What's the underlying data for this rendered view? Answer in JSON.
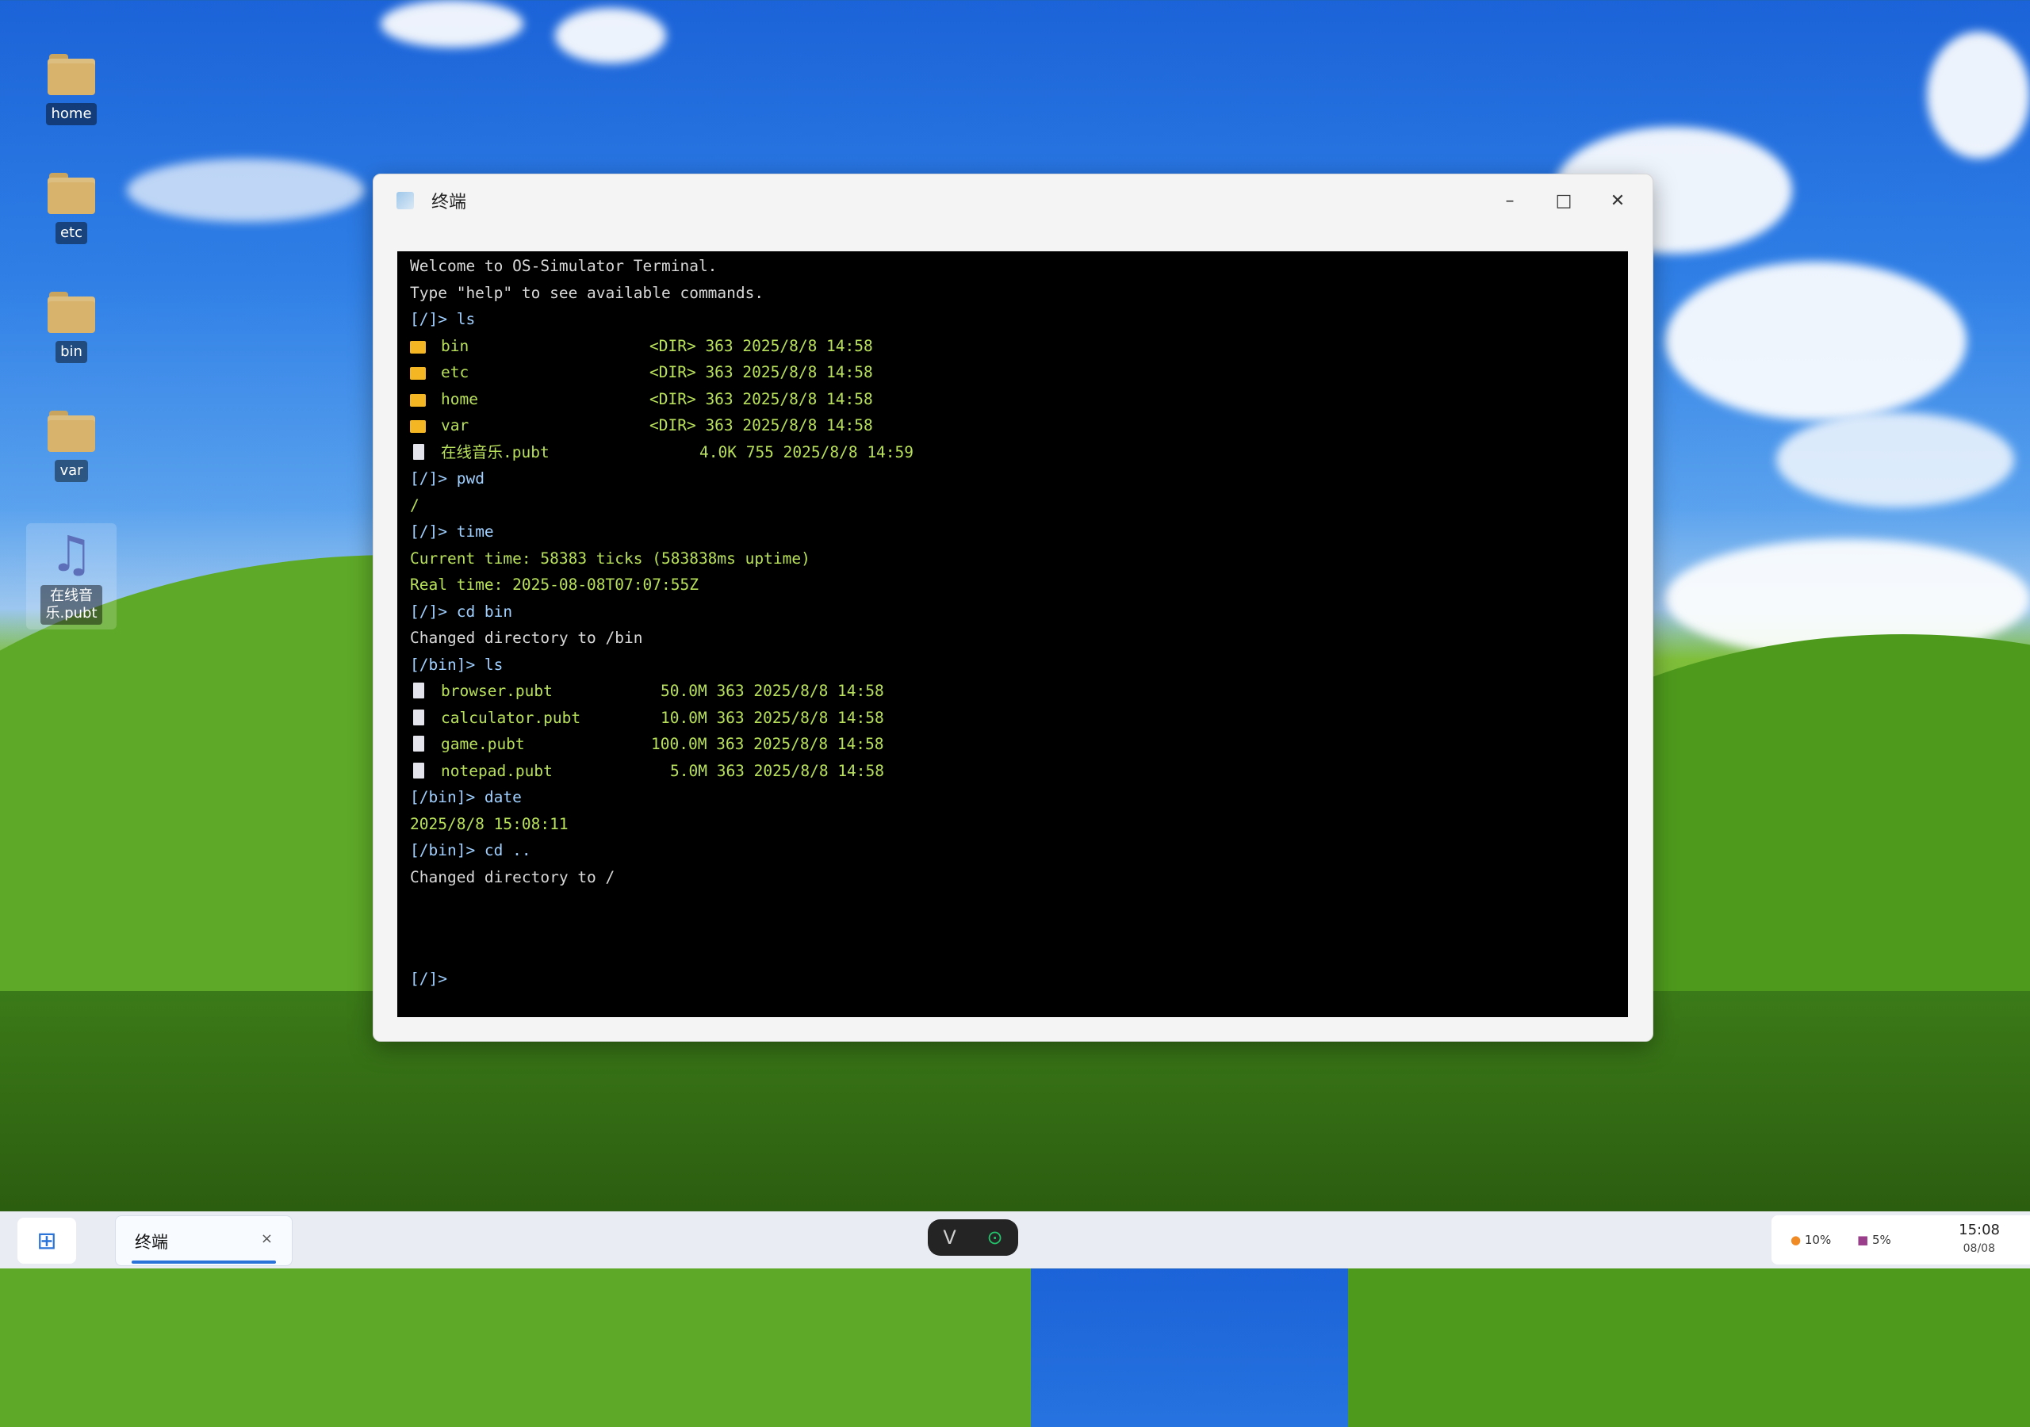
{
  "desktop": {
    "icons": [
      {
        "label": "home",
        "icon": "folder-icon"
      },
      {
        "label": "etc",
        "icon": "folder-icon"
      },
      {
        "label": "bin",
        "icon": "folder-icon"
      },
      {
        "label": "var",
        "icon": "folder-icon"
      },
      {
        "label": "在线音乐.pubt",
        "label_line1": "在线音",
        "label_line2": "乐.pubt",
        "icon": "music-note-icon"
      }
    ]
  },
  "window": {
    "title": "终端",
    "controls": {
      "minimize": "–",
      "maximize": "□",
      "close": "✕"
    }
  },
  "terminal": {
    "welcome": "Welcome to OS-Simulator Terminal.",
    "hint": "Type \"help\" to see available commands.",
    "ls_root_prompt": "[/]>",
    "ls_root_cmd": " ls",
    "root_entries": [
      {
        "name": "bin",
        "meta": "<DIR> 363 2025/8/8 14:58",
        "type": "dir"
      },
      {
        "name": "etc",
        "meta": "<DIR> 363 2025/8/8 14:58",
        "type": "dir"
      },
      {
        "name": "home",
        "meta": "<DIR> 363 2025/8/8 14:58",
        "type": "dir"
      },
      {
        "name": "var",
        "meta": "<DIR> 363 2025/8/8 14:58",
        "type": "dir"
      },
      {
        "name": "在线音乐.pubt",
        "meta": "4.0K 755 2025/8/8 14:59",
        "type": "file"
      }
    ],
    "pwd_prompt": "[/]>",
    "pwd_cmd": " pwd",
    "pwd_output": "/",
    "time_prompt": "[/]>",
    "time_cmd": " time",
    "time_output1": "Current time: 58383 ticks (583838ms uptime)",
    "time_output2": "Real time: 2025-08-08T07:07:55Z",
    "cd_prompt": "[/]>",
    "cd_cmd": " cd bin",
    "cd_output": "Changed directory to /bin",
    "ls_bin_prompt": "[/bin]>",
    "ls_bin_cmd": " ls",
    "bin_entries": [
      {
        "name": "browser.pubt",
        "meta": "50.0M 363 2025/8/8 14:58"
      },
      {
        "name": "calculator.pubt",
        "meta": "10.0M 363 2025/8/8 14:58"
      },
      {
        "name": "game.pubt",
        "meta": "100.0M 363 2025/8/8 14:58"
      },
      {
        "name": "notepad.pubt",
        "meta": "5.0M 363 2025/8/8 14:58"
      }
    ],
    "date_prompt": "[/bin]>",
    "date_cmd": " date",
    "date_output": "2025/8/8 15:08:11",
    "cdup_prompt": "[/bin]>",
    "cdup_cmd": " cd ..",
    "cdup_output": "Changed directory to /",
    "final_prompt": "[/]>"
  },
  "taskbar": {
    "start_icon": "grid-icon",
    "task_label": "终端",
    "task_close": "×",
    "dock_icons": [
      "v-logo-icon",
      "target-icon"
    ],
    "tray": {
      "cpu": "10%",
      "memory": "5%",
      "time": "15:08",
      "date": "08/08"
    }
  },
  "colors": {
    "terminal_bg": "#000000",
    "prompt": "#9fd0ff",
    "output_green": "#b8e05a",
    "folder": "#f5b623",
    "accent": "#2a73d8"
  }
}
